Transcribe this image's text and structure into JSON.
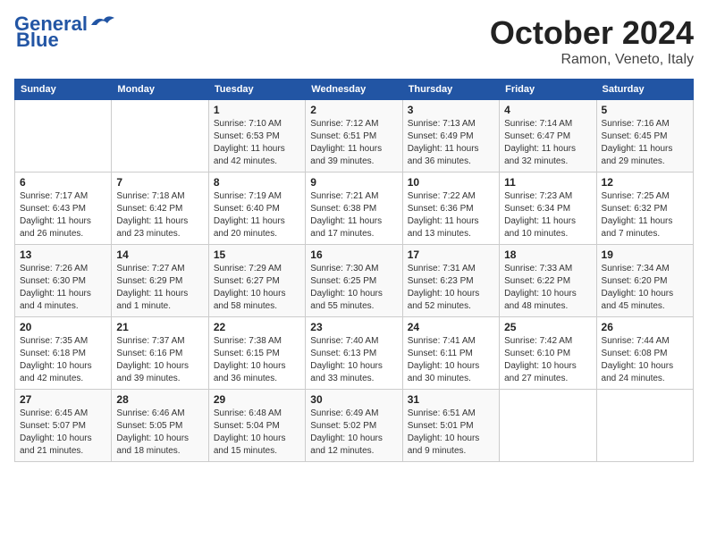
{
  "logo": {
    "line1": "General",
    "line2": "Blue"
  },
  "title": "October 2024",
  "subtitle": "Ramon, Veneto, Italy",
  "headers": [
    "Sunday",
    "Monday",
    "Tuesday",
    "Wednesday",
    "Thursday",
    "Friday",
    "Saturday"
  ],
  "weeks": [
    [
      {
        "day": "",
        "info": ""
      },
      {
        "day": "",
        "info": ""
      },
      {
        "day": "1",
        "info": "Sunrise: 7:10 AM\nSunset: 6:53 PM\nDaylight: 11 hours and 42 minutes."
      },
      {
        "day": "2",
        "info": "Sunrise: 7:12 AM\nSunset: 6:51 PM\nDaylight: 11 hours and 39 minutes."
      },
      {
        "day": "3",
        "info": "Sunrise: 7:13 AM\nSunset: 6:49 PM\nDaylight: 11 hours and 36 minutes."
      },
      {
        "day": "4",
        "info": "Sunrise: 7:14 AM\nSunset: 6:47 PM\nDaylight: 11 hours and 32 minutes."
      },
      {
        "day": "5",
        "info": "Sunrise: 7:16 AM\nSunset: 6:45 PM\nDaylight: 11 hours and 29 minutes."
      }
    ],
    [
      {
        "day": "6",
        "info": "Sunrise: 7:17 AM\nSunset: 6:43 PM\nDaylight: 11 hours and 26 minutes."
      },
      {
        "day": "7",
        "info": "Sunrise: 7:18 AM\nSunset: 6:42 PM\nDaylight: 11 hours and 23 minutes."
      },
      {
        "day": "8",
        "info": "Sunrise: 7:19 AM\nSunset: 6:40 PM\nDaylight: 11 hours and 20 minutes."
      },
      {
        "day": "9",
        "info": "Sunrise: 7:21 AM\nSunset: 6:38 PM\nDaylight: 11 hours and 17 minutes."
      },
      {
        "day": "10",
        "info": "Sunrise: 7:22 AM\nSunset: 6:36 PM\nDaylight: 11 hours and 13 minutes."
      },
      {
        "day": "11",
        "info": "Sunrise: 7:23 AM\nSunset: 6:34 PM\nDaylight: 11 hours and 10 minutes."
      },
      {
        "day": "12",
        "info": "Sunrise: 7:25 AM\nSunset: 6:32 PM\nDaylight: 11 hours and 7 minutes."
      }
    ],
    [
      {
        "day": "13",
        "info": "Sunrise: 7:26 AM\nSunset: 6:30 PM\nDaylight: 11 hours and 4 minutes."
      },
      {
        "day": "14",
        "info": "Sunrise: 7:27 AM\nSunset: 6:29 PM\nDaylight: 11 hours and 1 minute."
      },
      {
        "day": "15",
        "info": "Sunrise: 7:29 AM\nSunset: 6:27 PM\nDaylight: 10 hours and 58 minutes."
      },
      {
        "day": "16",
        "info": "Sunrise: 7:30 AM\nSunset: 6:25 PM\nDaylight: 10 hours and 55 minutes."
      },
      {
        "day": "17",
        "info": "Sunrise: 7:31 AM\nSunset: 6:23 PM\nDaylight: 10 hours and 52 minutes."
      },
      {
        "day": "18",
        "info": "Sunrise: 7:33 AM\nSunset: 6:22 PM\nDaylight: 10 hours and 48 minutes."
      },
      {
        "day": "19",
        "info": "Sunrise: 7:34 AM\nSunset: 6:20 PM\nDaylight: 10 hours and 45 minutes."
      }
    ],
    [
      {
        "day": "20",
        "info": "Sunrise: 7:35 AM\nSunset: 6:18 PM\nDaylight: 10 hours and 42 minutes."
      },
      {
        "day": "21",
        "info": "Sunrise: 7:37 AM\nSunset: 6:16 PM\nDaylight: 10 hours and 39 minutes."
      },
      {
        "day": "22",
        "info": "Sunrise: 7:38 AM\nSunset: 6:15 PM\nDaylight: 10 hours and 36 minutes."
      },
      {
        "day": "23",
        "info": "Sunrise: 7:40 AM\nSunset: 6:13 PM\nDaylight: 10 hours and 33 minutes."
      },
      {
        "day": "24",
        "info": "Sunrise: 7:41 AM\nSunset: 6:11 PM\nDaylight: 10 hours and 30 minutes."
      },
      {
        "day": "25",
        "info": "Sunrise: 7:42 AM\nSunset: 6:10 PM\nDaylight: 10 hours and 27 minutes."
      },
      {
        "day": "26",
        "info": "Sunrise: 7:44 AM\nSunset: 6:08 PM\nDaylight: 10 hours and 24 minutes."
      }
    ],
    [
      {
        "day": "27",
        "info": "Sunrise: 6:45 AM\nSunset: 5:07 PM\nDaylight: 10 hours and 21 minutes."
      },
      {
        "day": "28",
        "info": "Sunrise: 6:46 AM\nSunset: 5:05 PM\nDaylight: 10 hours and 18 minutes."
      },
      {
        "day": "29",
        "info": "Sunrise: 6:48 AM\nSunset: 5:04 PM\nDaylight: 10 hours and 15 minutes."
      },
      {
        "day": "30",
        "info": "Sunrise: 6:49 AM\nSunset: 5:02 PM\nDaylight: 10 hours and 12 minutes."
      },
      {
        "day": "31",
        "info": "Sunrise: 6:51 AM\nSunset: 5:01 PM\nDaylight: 10 hours and 9 minutes."
      },
      {
        "day": "",
        "info": ""
      },
      {
        "day": "",
        "info": ""
      }
    ]
  ]
}
